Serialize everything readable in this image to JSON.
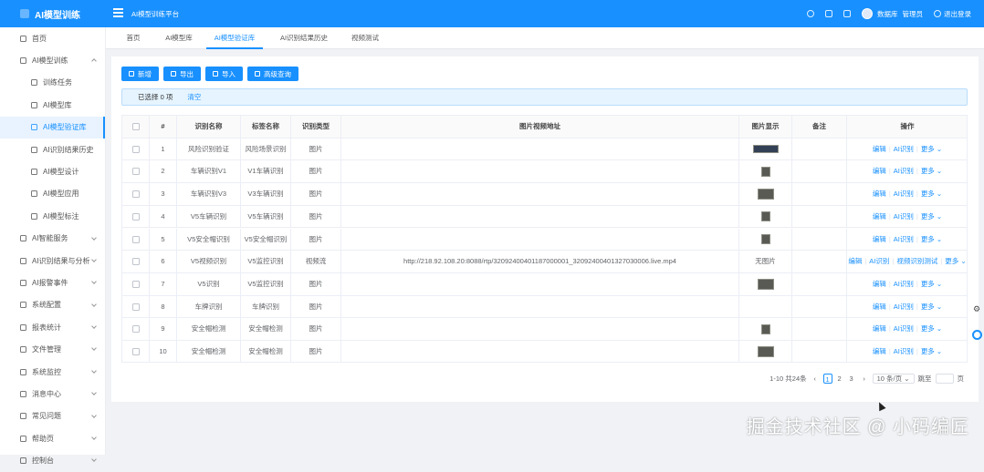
{
  "app": {
    "title": "AI模型训练"
  },
  "header": {
    "breadcrumb": "AI模型训练平台",
    "user_name": "数据库",
    "user_role": "管理员",
    "logout": "退出登录"
  },
  "sidebar": {
    "items": [
      {
        "label": "首页",
        "icon": "home-icon"
      },
      {
        "label": "AI模型训练",
        "icon": "robot-icon",
        "expanded": true
      },
      {
        "label": "训练任务",
        "sub": true
      },
      {
        "label": "AI模型库",
        "sub": true,
        "icon": "model-icon"
      },
      {
        "label": "AI模型验证库",
        "sub": true,
        "icon": "verify-icon",
        "active": true
      },
      {
        "label": "AI识别结果历史",
        "sub": true,
        "icon": "history-icon"
      },
      {
        "label": "AI模型设计",
        "sub": true,
        "icon": "design-icon"
      },
      {
        "label": "AI模型应用",
        "sub": true,
        "icon": "apply-icon"
      },
      {
        "label": "AI模型标注",
        "sub": true,
        "icon": "tag-icon"
      },
      {
        "label": "AI智能服务",
        "icon": "service-icon"
      },
      {
        "label": "AI识别结果与分析",
        "icon": "share-icon"
      },
      {
        "label": "AI报警事件",
        "icon": "alarm-icon"
      },
      {
        "label": "系统配置",
        "icon": "settings-icon"
      },
      {
        "label": "报表统计",
        "icon": "chart-icon"
      },
      {
        "label": "文件管理",
        "icon": "file-icon"
      },
      {
        "label": "系统监控",
        "icon": "monitor-icon"
      },
      {
        "label": "消息中心",
        "icon": "message-icon"
      },
      {
        "label": "常见问题",
        "icon": "help-icon"
      },
      {
        "label": "帮助页",
        "icon": "book-icon"
      },
      {
        "label": "控制台",
        "icon": "console-icon"
      }
    ]
  },
  "tabs": [
    {
      "label": "首页"
    },
    {
      "label": "AI模型库"
    },
    {
      "label": "AI模型验证库",
      "active": true
    },
    {
      "label": "AI识别结果历史"
    },
    {
      "label": "视频测试"
    }
  ],
  "toolbar": {
    "add": "新增",
    "export": "导出",
    "import": "导入",
    "advanced": "高级查询"
  },
  "alert": {
    "text": "已选择 0 项",
    "clear": "清空"
  },
  "table": {
    "columns": [
      "#",
      "识别名称",
      "标签名称",
      "识别类型",
      "图片视频地址",
      "图片显示",
      "备注",
      "操作"
    ],
    "ops": {
      "edit": "编辑",
      "ai": "AI识别",
      "more": "更多",
      "video": "视频识别测试"
    },
    "rows": [
      {
        "no": "1",
        "name": "风险识别验证",
        "label": "风险场景识别",
        "type": "图片",
        "url": "",
        "thumb": "banner",
        "note": ""
      },
      {
        "no": "2",
        "name": "车辆识别V1",
        "label": "V1车辆识别",
        "type": "图片",
        "url": "",
        "thumb": "small",
        "note": ""
      },
      {
        "no": "3",
        "name": "车辆识别V3",
        "label": "V3车辆识别",
        "type": "图片",
        "url": "",
        "thumb": "wide",
        "note": ""
      },
      {
        "no": "4",
        "name": "V5车辆识别",
        "label": "V5车辆识别",
        "type": "图片",
        "url": "",
        "thumb": "small",
        "note": ""
      },
      {
        "no": "5",
        "name": "V5安全帽识别",
        "label": "V5安全帽识别",
        "type": "图片",
        "url": "",
        "thumb": "small",
        "note": ""
      },
      {
        "no": "6",
        "name": "V5视频识别",
        "label": "V5监控识别",
        "type": "视频流",
        "url": "http://218.92.108.20:8088/rtp/32092400401187000001_32092400401327030006.live.mp4",
        "thumb": "",
        "note": "无图片",
        "video": true
      },
      {
        "no": "7",
        "name": "V5识别",
        "label": "V5监控识别",
        "type": "图片",
        "url": "",
        "thumb": "wide",
        "note": ""
      },
      {
        "no": "8",
        "name": "车牌识别",
        "label": "车牌识别",
        "type": "图片",
        "url": "",
        "thumb": "",
        "note": ""
      },
      {
        "no": "9",
        "name": "安全帽检测",
        "label": "安全帽检测",
        "type": "图片",
        "url": "",
        "thumb": "small",
        "note": ""
      },
      {
        "no": "10",
        "name": "安全帽检测",
        "label": "安全帽检测",
        "type": "图片",
        "url": "",
        "thumb": "wide",
        "note": ""
      }
    ]
  },
  "pager": {
    "summary": "1-10 共24条",
    "pages": [
      "1",
      "2",
      "3"
    ],
    "current": "1",
    "size": "10 条/页",
    "goto": "跳至",
    "page_unit": "页"
  },
  "watermark": "掘金技术社区 @ 小码编匠",
  "colors": {
    "primary": "#1890ff",
    "header": "#1890ff"
  }
}
